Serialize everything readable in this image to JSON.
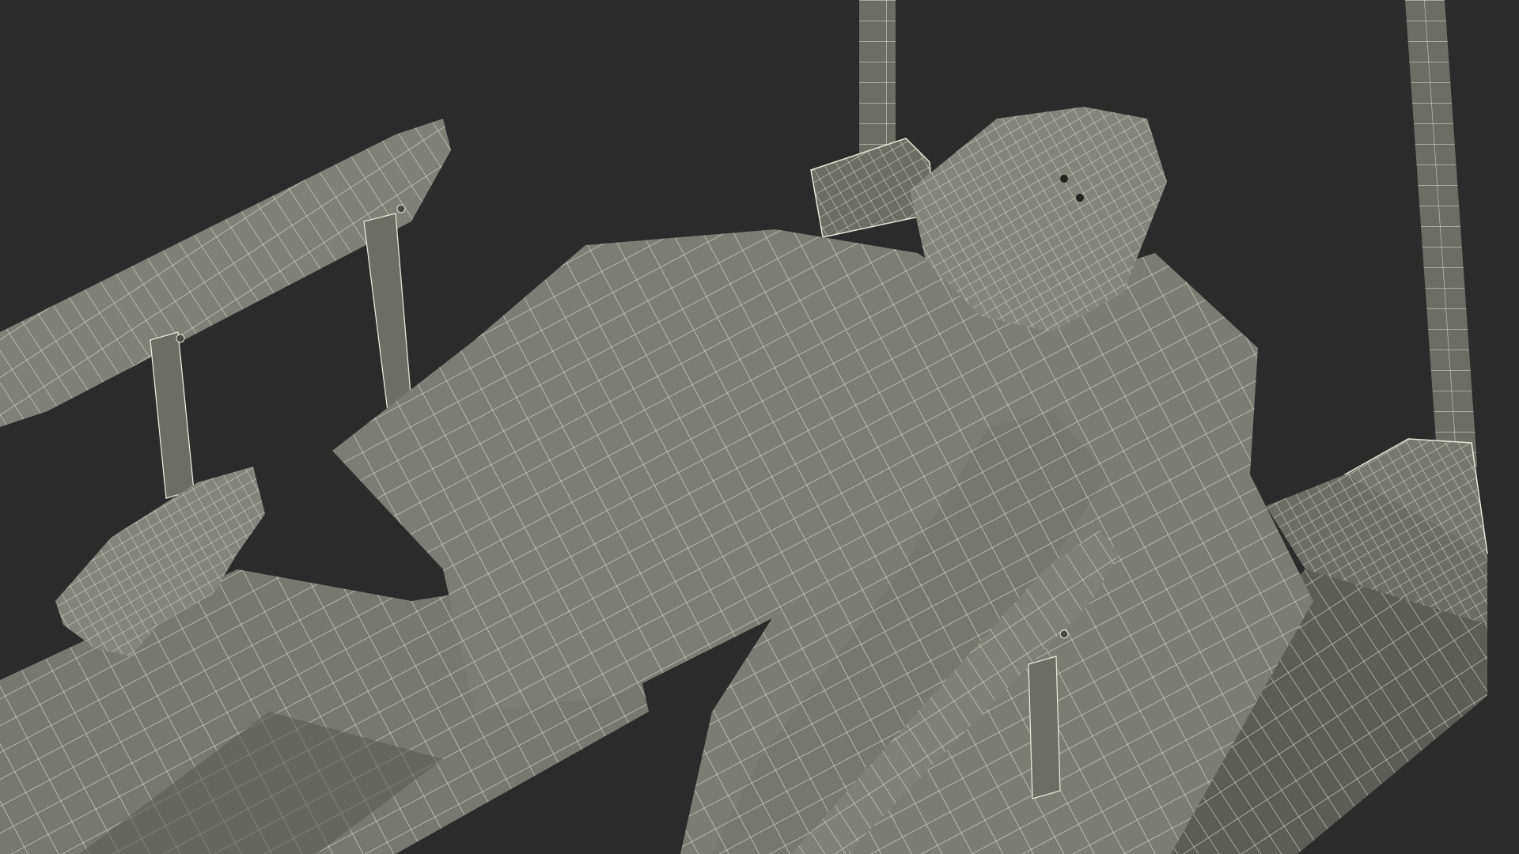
{
  "colors": {
    "background": "#2b2b2b",
    "surface_light": "#7f8077",
    "surface_mid": "#6c6d65",
    "surface_dark": "#4a4b45",
    "shadow": "#222220",
    "wire": "#e6e6d8"
  }
}
